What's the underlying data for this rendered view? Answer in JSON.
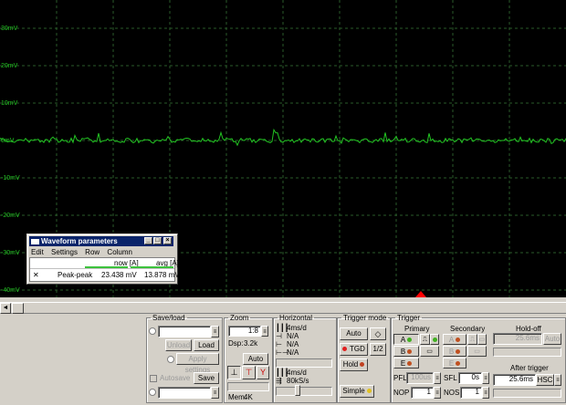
{
  "scope": {
    "y_labels": [
      "30mV",
      "20mV",
      "10mV",
      "0mV",
      "-10mV",
      "-20mV",
      "-30mV",
      "-40mV"
    ],
    "trace_color": "#22c422",
    "trigger_marker_color": "#ff0000"
  },
  "scrollbar": {
    "left_arrow": "◄"
  },
  "waveform_window": {
    "title": "Waveform parameters",
    "menu": [
      "Edit",
      "Settings",
      "Row",
      "Column"
    ],
    "col_now": "now [A]",
    "col_avg": "avg [A]",
    "row_marker": "✕",
    "row_label": "Peak-peak",
    "row_now": "23.438 mV",
    "row_avg": "13.878 mV"
  },
  "save_load": {
    "title": "Save/load",
    "unload": "Unload",
    "load": "Load",
    "apply_settings": "Apply settings",
    "autosave": "Autosave",
    "save": "Save"
  },
  "zoom": {
    "title": "Zoom",
    "ratio": "1:8",
    "dsp_label": "Dsp:",
    "dsp_value": "3.2k",
    "auto": "Auto",
    "mem_label": "Mem:",
    "mem_value": "4K"
  },
  "horizontal": {
    "title": "Horizontal",
    "rows": [
      "4ms/d",
      "N/A",
      "N/A",
      "N/A"
    ],
    "bottom_rows": [
      "4ms/d",
      "80kS/s"
    ]
  },
  "trigger_mode": {
    "title": "Trigger mode",
    "auto": "Auto",
    "tgd": "TGD",
    "half": "1/2",
    "hold": "Hold",
    "simple": "Simple"
  },
  "trigger": {
    "title": "Trigger",
    "primary": "Primary",
    "secondary": "Secondary",
    "holdoff": "Hold-off",
    "channels_primary": [
      "A",
      "B",
      "E"
    ],
    "channels_secondary": [
      "A",
      "B",
      "E"
    ],
    "holdoff_value": "25.6ms",
    "holdoff_auto": "Auto",
    "after_trigger": "After trigger",
    "after_value": "25.6ms",
    "hsc": "HSC",
    "pfl_label": "PFL",
    "pfl_value": "100us",
    "sfl_label": "SFL",
    "sfl_value": "0s",
    "nop_label": "NOP",
    "nop_value": "1",
    "nos_label": "NOS",
    "nos_value": "1"
  }
}
